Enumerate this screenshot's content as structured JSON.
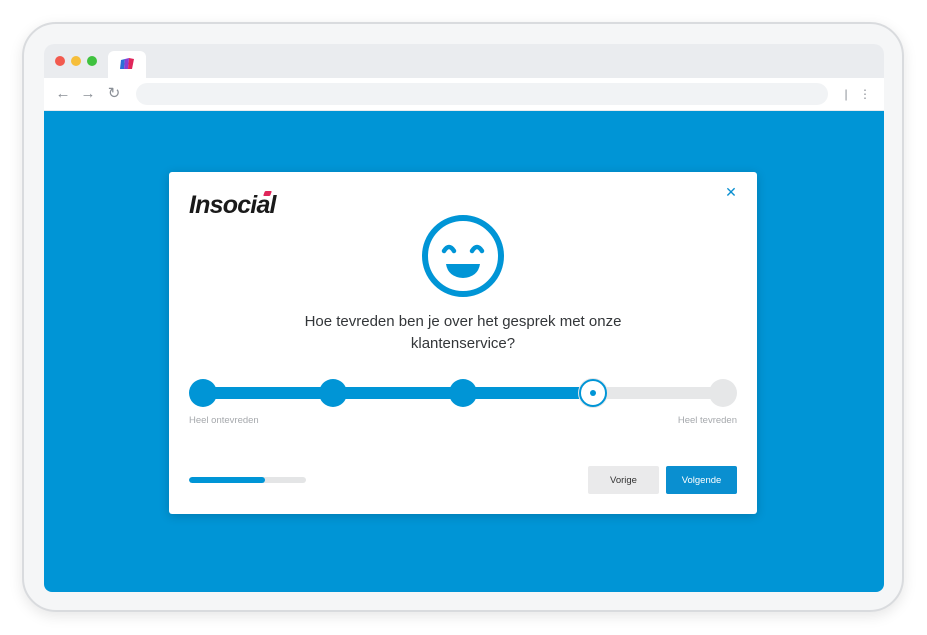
{
  "browser": {
    "url": "",
    "colors": {
      "viewport_bg": "#0095d6",
      "accent": "#0095d6",
      "close_dot": "#f25a4f",
      "minimize_dot": "#f6be3a",
      "maximize_dot": "#3fc23f"
    }
  },
  "survey": {
    "logo_text": "Insocial",
    "question_line1": "Hoe tevreden ben je over het gesprek met onze",
    "question_line2": "klantenservice?",
    "icon": "smiley-face-icon",
    "scale": {
      "min_label": "Heel ontevreden",
      "max_label": "Heel tevreden",
      "steps": 5,
      "selected": 4
    },
    "progress_fraction": 0.65,
    "buttons": {
      "prev_label": "Vorige",
      "next_label": "Volgende"
    }
  }
}
